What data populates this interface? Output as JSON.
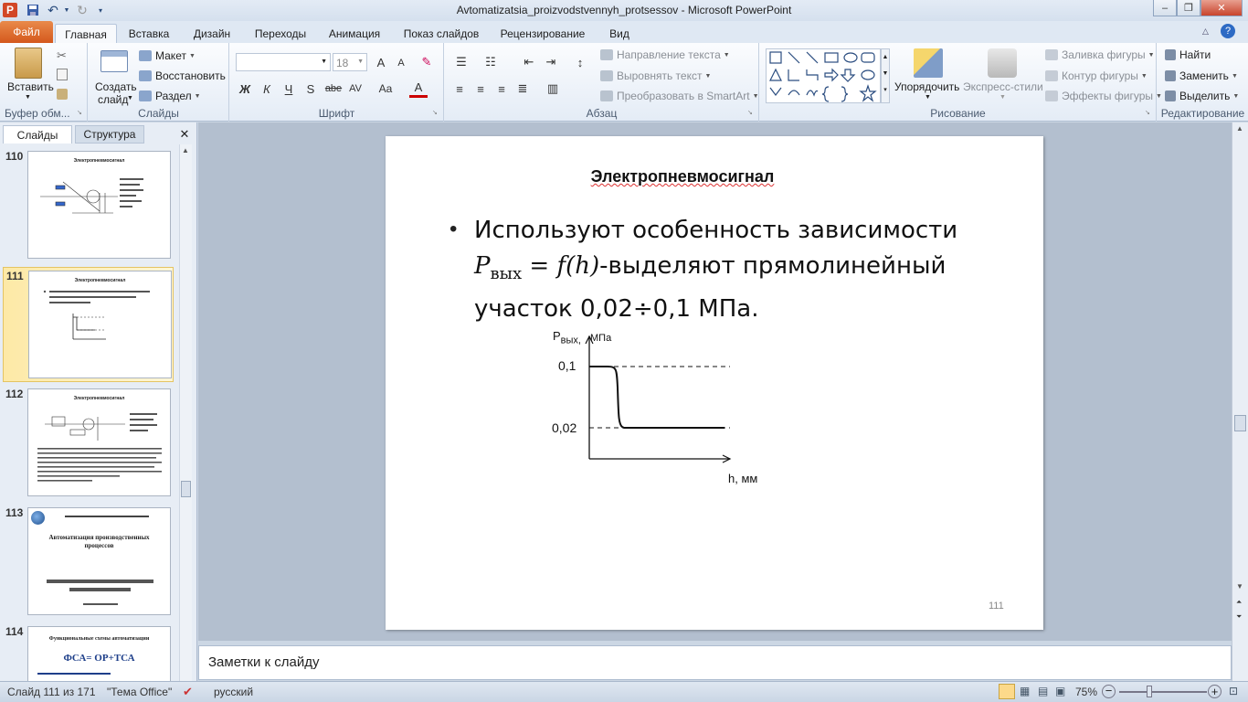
{
  "window": {
    "title": "Avtomatizatsia_proizvodstvennyh_protsessov  -  Microsoft PowerPoint",
    "app_icon": "P",
    "minimize": "–",
    "maximize": "❐",
    "close": "✕"
  },
  "tabs": {
    "file": "Файл",
    "items": [
      "Главная",
      "Вставка",
      "Дизайн",
      "Переходы",
      "Анимация",
      "Показ слайдов",
      "Рецензирование",
      "Вид"
    ],
    "active": "Главная"
  },
  "ribbon": {
    "clipboard": {
      "label": "Буфер обм...",
      "paste": "Вставить"
    },
    "slides": {
      "label": "Слайды",
      "new_slide_line1": "Создать",
      "new_slide_line2": "слайд",
      "layout": "Макет",
      "reset": "Восстановить",
      "section": "Раздел"
    },
    "font": {
      "label": "Шрифт",
      "size": "18",
      "bold": "Ж",
      "italic": "К",
      "underline": "Ч",
      "shadow": "S",
      "strike": "abe",
      "spacing": "AV",
      "case": "Aa",
      "color": "A",
      "grow": "A",
      "shrink": "A"
    },
    "paragraph": {
      "label": "Абзац",
      "text_direction": "Направление текста",
      "align_text": "Выровнять текст",
      "smartart": "Преобразовать в SmartArt"
    },
    "drawing": {
      "label": "Рисование",
      "arrange": "Упорядочить",
      "quick_styles": "Экспресс-стили",
      "fill": "Заливка фигуры",
      "outline": "Контур фигуры",
      "effects": "Эффекты фигуры"
    },
    "editing": {
      "label": "Редактирование",
      "find": "Найти",
      "replace": "Заменить",
      "select": "Выделить"
    }
  },
  "panel": {
    "tab_slides": "Слайды",
    "tab_outline": "Структура",
    "close": "✕",
    "thumbnails": [
      {
        "number": "110",
        "title": "Электропневмосигнал"
      },
      {
        "number": "111",
        "title": "Электропневмосигнал",
        "selected": true
      },
      {
        "number": "112",
        "title": "Электропневмосигнал"
      },
      {
        "number": "113",
        "title": "Автоматизация производственных процессов"
      },
      {
        "number": "114",
        "title": "Функциональные схемы автоматизации",
        "subtitle": "ФСА= ОР+ТСА"
      }
    ]
  },
  "slide": {
    "title": "Электропневмосигнал",
    "bullet_line1": "Используют особенность зависимости",
    "bullet_formula_P": "P",
    "bullet_formula_sub": "вых",
    "bullet_formula_rest": " = f(h)",
    "bullet_line2_tail": "-выделяют прямолинейный",
    "bullet_line3": "участок 0,02÷0,1 МПа.",
    "page_number": "111",
    "chart": {
      "ylabel_main": "P",
      "ylabel_sub": "вых,",
      "ylabel_unit": "МПа",
      "xlabel": "h, мм",
      "tick_high": "0,1",
      "tick_low": "0,02"
    }
  },
  "chart_data": {
    "type": "line",
    "series": [
      {
        "values_description_free": true,
        "x": [
          0,
          0.05,
          0.1,
          0.14,
          0.15,
          0.2,
          0.4,
          0.6,
          0.95
        ],
        "y": [
          0.1,
          0.1,
          0.1,
          0.07,
          0.02,
          0.02,
          0.02,
          0.02,
          0.02
        ]
      }
    ],
    "reference_lines_y": [
      0.1,
      0.02
    ]
  },
  "notes": {
    "placeholder": "Заметки к слайду"
  },
  "status": {
    "slide_counter": "Слайд 111 из 171",
    "theme": "\"Тема Office\"",
    "language": "русский",
    "zoom": "75%"
  }
}
